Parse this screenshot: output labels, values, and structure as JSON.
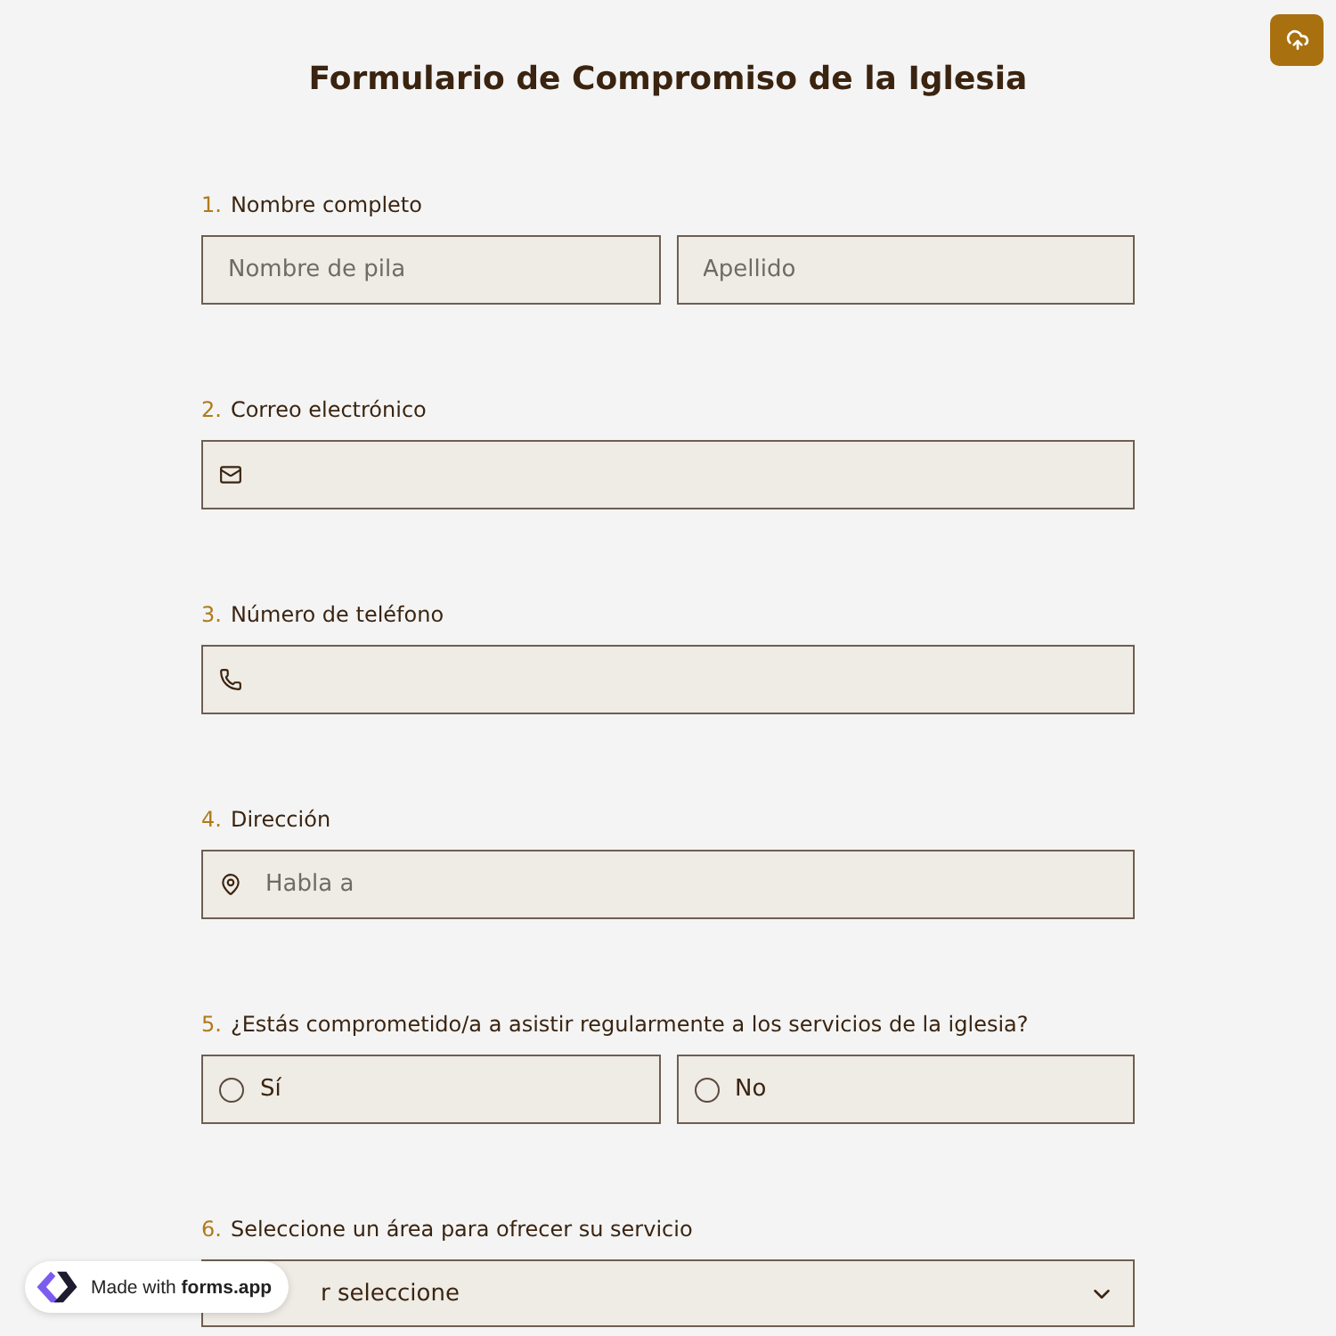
{
  "title": "Formulario de Compromiso de la Iglesia",
  "questions": [
    {
      "number": "1.",
      "label": "Nombre completo",
      "kind": "name",
      "fields": [
        {
          "placeholder": "Nombre de pila"
        },
        {
          "placeholder": "Apellido"
        }
      ]
    },
    {
      "number": "2.",
      "label": "Correo electrónico",
      "kind": "email"
    },
    {
      "number": "3.",
      "label": "Número de teléfono",
      "kind": "phone"
    },
    {
      "number": "4.",
      "label": "Dirección",
      "kind": "address",
      "placeholder": "Habla a"
    },
    {
      "number": "5.",
      "label": "¿Estás comprometido/a a asistir regularmente a los servicios de la iglesia?",
      "kind": "radio",
      "options": [
        {
          "label": "Sí",
          "selected": false
        },
        {
          "label": "No",
          "selected": false
        }
      ]
    },
    {
      "number": "6.",
      "label": "Seleccione un área para ofrecer su servicio",
      "kind": "select",
      "value": "r seleccione"
    }
  ],
  "badge": {
    "text": "Made with **forms.app**"
  }
}
